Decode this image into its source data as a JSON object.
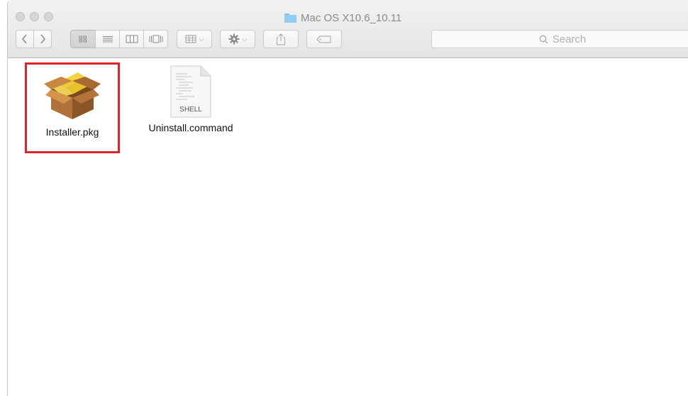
{
  "window": {
    "title": "Mac OS X10.6_10.11"
  },
  "toolbar": {
    "back_icon": "chevron-left-icon",
    "forward_icon": "chevron-right-icon",
    "view_modes": [
      "icon-view-icon",
      "list-view-icon",
      "column-view-icon",
      "cover-flow-icon"
    ],
    "arrange_icon": "arrange-grid-icon",
    "action_icon": "gear-icon",
    "share_icon": "share-icon",
    "tag_icon": "tag-icon",
    "search_placeholder": "Search"
  },
  "files": [
    {
      "name": "Installer.pkg",
      "icon": "package-icon",
      "selected": true
    },
    {
      "name": "Uninstall.command",
      "icon": "shell-script-icon",
      "badge": "SHELL",
      "selected": false
    }
  ],
  "colors": {
    "selection_outline": "#e0222b",
    "folder": "#8fcdf2"
  }
}
